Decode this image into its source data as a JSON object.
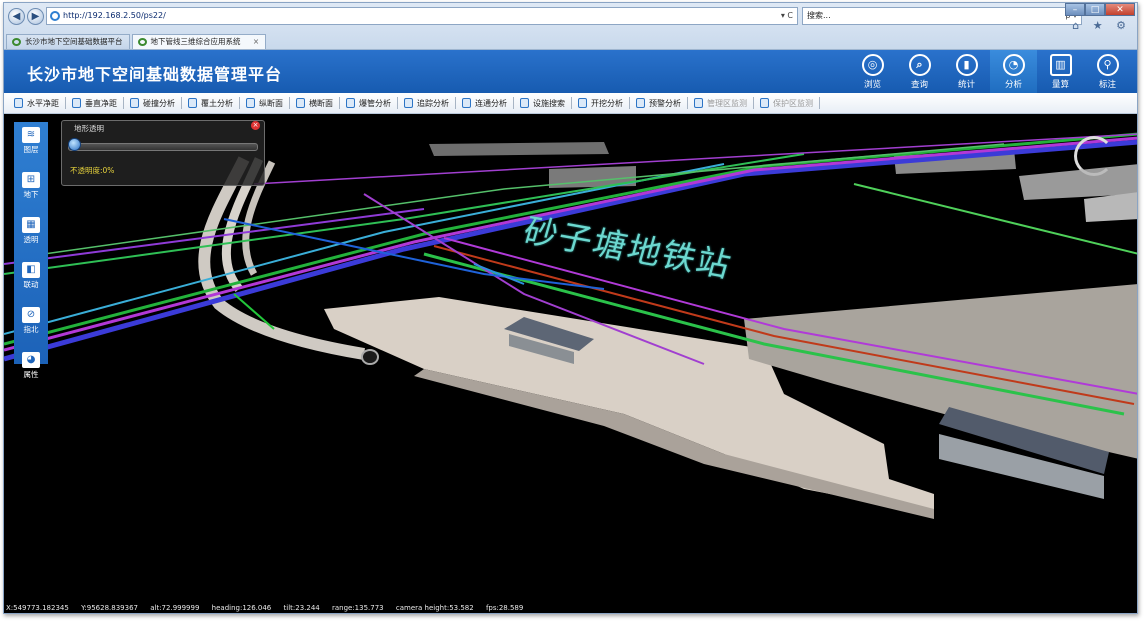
{
  "browser": {
    "url": "http://192.168.2.50/ps22/",
    "search_placeholder": "搜索...",
    "refresh_glyph": "▾ C",
    "search_glyph": "ρ ▾",
    "window_controls": [
      "–",
      "□",
      "✕"
    ],
    "toolbar_icons": "⌂ ★ ⚙",
    "tabs": [
      {
        "title": "长沙市地下空间基础数据平台",
        "active": false
      },
      {
        "title": "地下管线三维综合应用系统",
        "active": true,
        "close": "×"
      }
    ]
  },
  "app": {
    "title": "长沙市地下空间基础数据管理平台",
    "modules": [
      {
        "label": "浏览",
        "icon": "target-icon",
        "glyph": "◎",
        "active": false
      },
      {
        "label": "查询",
        "icon": "query-icon",
        "glyph": "⌕",
        "active": false
      },
      {
        "label": "统计",
        "icon": "stats-icon",
        "glyph": "▮",
        "active": false
      },
      {
        "label": "分析",
        "icon": "analysis-icon",
        "glyph": "◔",
        "active": true
      },
      {
        "label": "量算",
        "icon": "ruler-icon",
        "glyph": "▥",
        "active": false
      },
      {
        "label": "标注",
        "icon": "pin-icon",
        "glyph": "⚲",
        "active": false
      }
    ]
  },
  "toolbar": {
    "items": [
      {
        "label": "水平净距",
        "enabled": true
      },
      {
        "label": "垂直净距",
        "enabled": true
      },
      {
        "label": "碰撞分析",
        "enabled": true
      },
      {
        "label": "覆土分析",
        "enabled": true
      },
      {
        "label": "纵断面",
        "enabled": true
      },
      {
        "label": "横断面",
        "enabled": true
      },
      {
        "label": "爆管分析",
        "enabled": true
      },
      {
        "label": "追踪分析",
        "enabled": true
      },
      {
        "label": "连通分析",
        "enabled": true
      },
      {
        "label": "设施搜索",
        "enabled": true
      },
      {
        "label": "开挖分析",
        "enabled": true
      },
      {
        "label": "预警分析",
        "enabled": true
      },
      {
        "label": "管理区监测",
        "enabled": false
      },
      {
        "label": "保护区监测",
        "enabled": false
      }
    ]
  },
  "left_panel": {
    "items": [
      {
        "label": "图层",
        "icon": "layers-icon",
        "glyph": "≋"
      },
      {
        "label": "地下",
        "icon": "underground-icon",
        "glyph": "⊞"
      },
      {
        "label": "透明",
        "icon": "transparent-icon",
        "glyph": "▦"
      },
      {
        "label": "联动",
        "icon": "link-icon",
        "glyph": "◧"
      },
      {
        "label": "指北",
        "icon": "north-icon",
        "glyph": "⊘"
      },
      {
        "label": "属性",
        "icon": "properties-icon",
        "glyph": "◕"
      }
    ]
  },
  "transparency_popup": {
    "title": "地形透明",
    "label": "不透明度:0%",
    "close": "×",
    "value": 0
  },
  "scene": {
    "station_label": "砂子塘地铁站"
  },
  "status": {
    "x": "X:549773.182345",
    "y": "Y:95628.839367",
    "alt": "alt:72.999999",
    "heading": "heading:126.046",
    "tilt": "tilt:23.244",
    "range": "range:135.773",
    "camera_height": "camera height:53.582",
    "fps": "fps:28.589"
  }
}
